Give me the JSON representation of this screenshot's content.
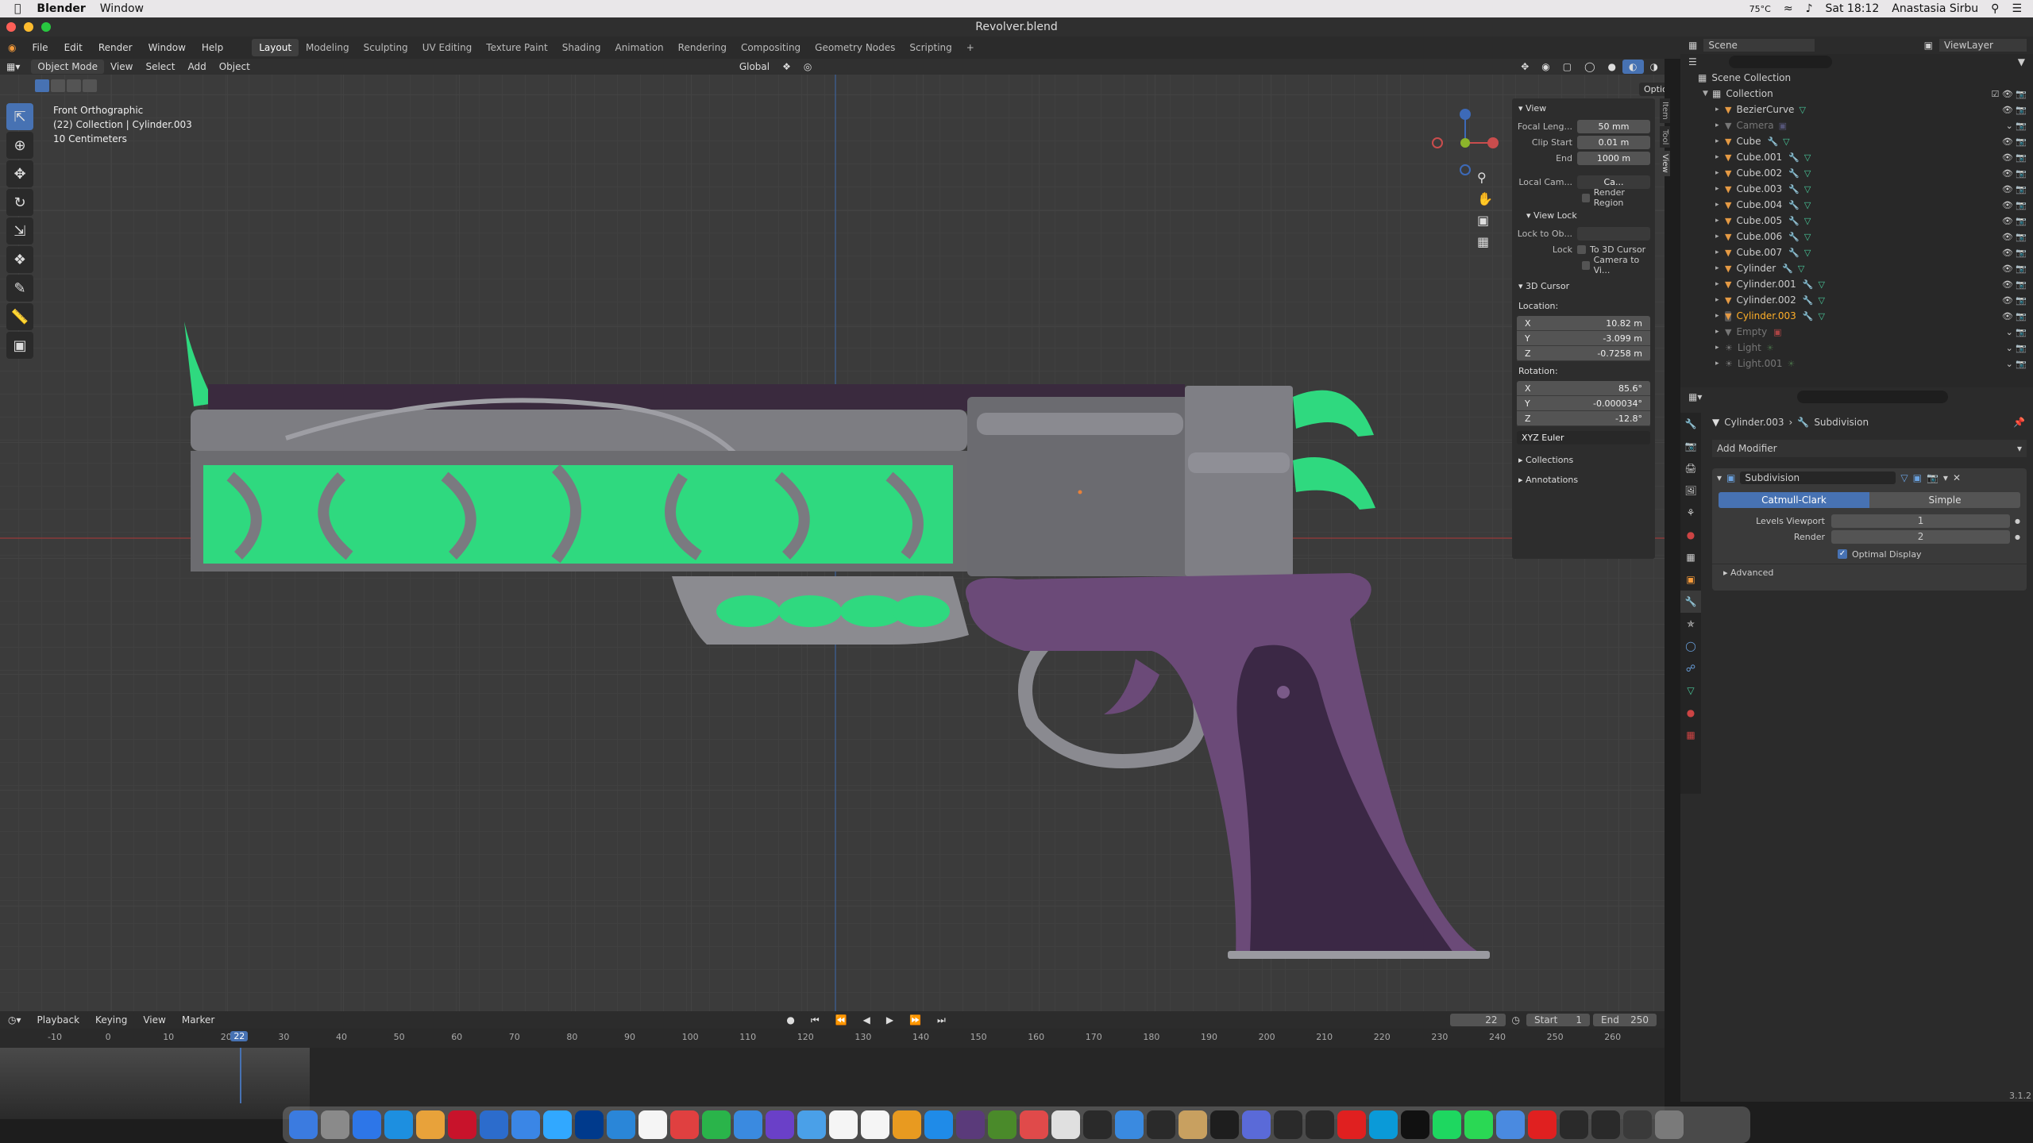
{
  "mac_menu": {
    "app": "Blender",
    "window": "Window",
    "temp": "75°C",
    "clock": "Sat 18:12",
    "user": "Anastasia Sirbu"
  },
  "window_title": "Revolver.blend",
  "top_menu": [
    "File",
    "Edit",
    "Render",
    "Window",
    "Help"
  ],
  "workspaces": [
    "Layout",
    "Modeling",
    "Sculpting",
    "UV Editing",
    "Texture Paint",
    "Shading",
    "Animation",
    "Rendering",
    "Compositing",
    "Geometry Nodes",
    "Scripting"
  ],
  "active_workspace": "Layout",
  "viewport_header": {
    "mode": "Object Mode",
    "menus": [
      "View",
      "Select",
      "Add",
      "Object"
    ],
    "orientation": "Global",
    "options": "Options"
  },
  "viewport_overlay": {
    "view_name": "Front Orthographic",
    "collection": "(22) Collection | Cylinder.003",
    "scale": "10 Centimeters"
  },
  "npanel": {
    "tabs": [
      "Item",
      "Tool",
      "View"
    ],
    "view_section": "View",
    "focal_label": "Focal Leng...",
    "focal_value": "50 mm",
    "clip_start_label": "Clip Start",
    "clip_start_value": "0.01 m",
    "clip_end_label": "End",
    "clip_end_value": "1000 m",
    "local_cam_label": "Local Cam...",
    "local_cam_value": "Ca...",
    "render_region": "Render Region",
    "view_lock_section": "View Lock",
    "lock_to_obj_label": "Lock to Ob...",
    "lock_label": "Lock",
    "to_3d_cursor": "To 3D Cursor",
    "camera_to_view": "Camera to Vi...",
    "cursor_section": "3D Cursor",
    "location_label": "Location:",
    "loc": [
      {
        "axis": "X",
        "value": "10.82 m"
      },
      {
        "axis": "Y",
        "value": "-3.099 m"
      },
      {
        "axis": "Z",
        "value": "-0.7258 m"
      }
    ],
    "rotation_label": "Rotation:",
    "rot": [
      {
        "axis": "X",
        "value": "85.6°"
      },
      {
        "axis": "Y",
        "value": "-0.000034°"
      },
      {
        "axis": "Z",
        "value": "-12.8°"
      }
    ],
    "rotation_mode": "XYZ Euler",
    "collections": "Collections",
    "annotations": "Annotations"
  },
  "outliner": {
    "scene": "Scene",
    "view_layer": "ViewLayer",
    "scene_collection": "Scene Collection",
    "collection": "Collection",
    "items": [
      "BezierCurve",
      "Camera",
      "Cube",
      "Cube.001",
      "Cube.002",
      "Cube.003",
      "Cube.004",
      "Cube.005",
      "Cube.006",
      "Cube.007",
      "Cylinder",
      "Cylinder.001",
      "Cylinder.002",
      "Cylinder.003",
      "Empty",
      "Light",
      "Light.001"
    ]
  },
  "properties": {
    "object_name": "Cylinder.003",
    "modifier_breadcrumb": "Subdivision",
    "add_modifier": "Add Modifier",
    "modifier_name": "Subdivision",
    "type_catmull": "Catmull-Clark",
    "type_simple": "Simple",
    "levels_viewport_label": "Levels Viewport",
    "levels_viewport_value": "1",
    "render_label": "Render",
    "render_value": "2",
    "optimal_display": "Optimal Display",
    "advanced": "Advanced"
  },
  "timeline": {
    "menus": [
      "Playback",
      "Keying",
      "View",
      "Marker"
    ],
    "current_frame": "22",
    "start_label": "Start",
    "start_value": "1",
    "end_label": "End",
    "end_value": "250",
    "ticks": [
      "-10",
      "0",
      "10",
      "20",
      "30",
      "40",
      "50",
      "60",
      "70",
      "80",
      "90",
      "100",
      "110",
      "120",
      "130",
      "140",
      "150",
      "160",
      "170",
      "180",
      "190",
      "200",
      "210",
      "220",
      "230",
      "240",
      "250",
      "260"
    ],
    "playhead": "22"
  },
  "version": "3.1.2",
  "colors": {
    "accent": "#4772b3",
    "green": "#2fd97f",
    "purple": "#6b4a78",
    "metal": "#8a8a8a"
  }
}
